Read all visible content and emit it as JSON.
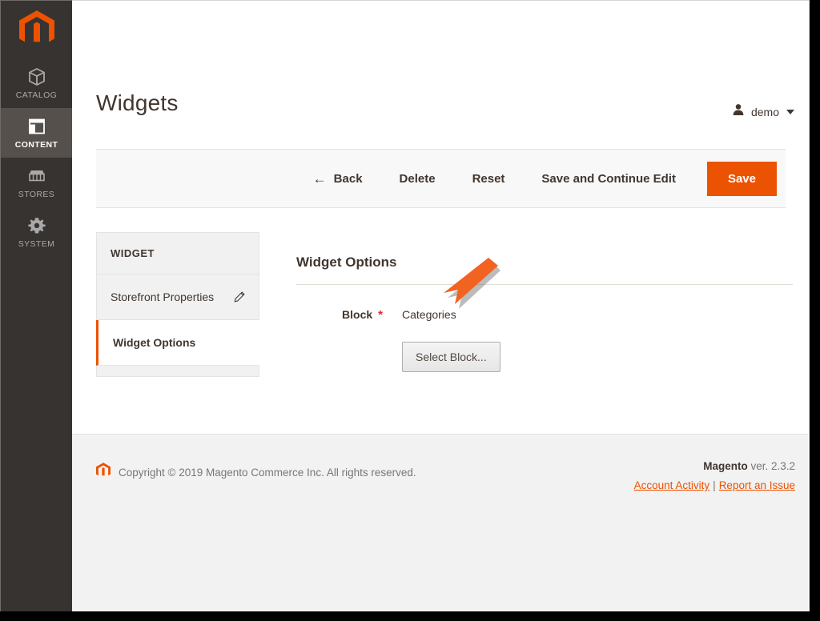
{
  "app": {
    "brand": "Magento",
    "accent_color": "#eb5202",
    "nav_bg": "#373330",
    "nav_active_bg": "#55504c",
    "required_color": "#e22626"
  },
  "sidebar": {
    "logo_name": "magento-logo-icon",
    "items": [
      {
        "label": "CATALOG",
        "icon": "box-icon",
        "active": false
      },
      {
        "label": "CONTENT",
        "icon": "layout-icon",
        "active": true
      },
      {
        "label": "STORES",
        "icon": "store-icon",
        "active": false
      },
      {
        "label": "SYSTEM",
        "icon": "gear-icon",
        "active": false
      }
    ]
  },
  "header": {
    "title": "Widgets",
    "user": {
      "name": "demo",
      "avatar_icon": "user-icon",
      "caret_icon": "chevron-down-icon"
    }
  },
  "toolbar": {
    "back_label": "Back",
    "back_icon": "arrow-left-icon",
    "delete_label": "Delete",
    "reset_label": "Reset",
    "save_continue_label": "Save and Continue Edit",
    "save_label": "Save"
  },
  "tabs_panel": {
    "heading": "WIDGET",
    "items": [
      {
        "label": "Storefront Properties",
        "icon": "pencil-icon",
        "active": false
      },
      {
        "label": "Widget Options",
        "icon": "",
        "active": true
      }
    ]
  },
  "main": {
    "section_title": "Widget Options",
    "fields": [
      {
        "label": "Block",
        "required_marker": "*",
        "value": "Categories"
      }
    ],
    "select_block_label": "Select Block..."
  },
  "annotation": {
    "type": "arrow",
    "color": "#f26322",
    "points_at": "Categories",
    "direction": "down-left"
  },
  "footer": {
    "logo_icon": "magento-logo-icon",
    "copyright": "Copyright © 2019 Magento Commerce Inc. All rights reserved.",
    "version_brand": "Magento",
    "version_text": " ver. 2.3.2",
    "links": [
      {
        "label": "Account Activity"
      },
      {
        "label": "Report an Issue"
      }
    ],
    "link_separator": "|"
  }
}
